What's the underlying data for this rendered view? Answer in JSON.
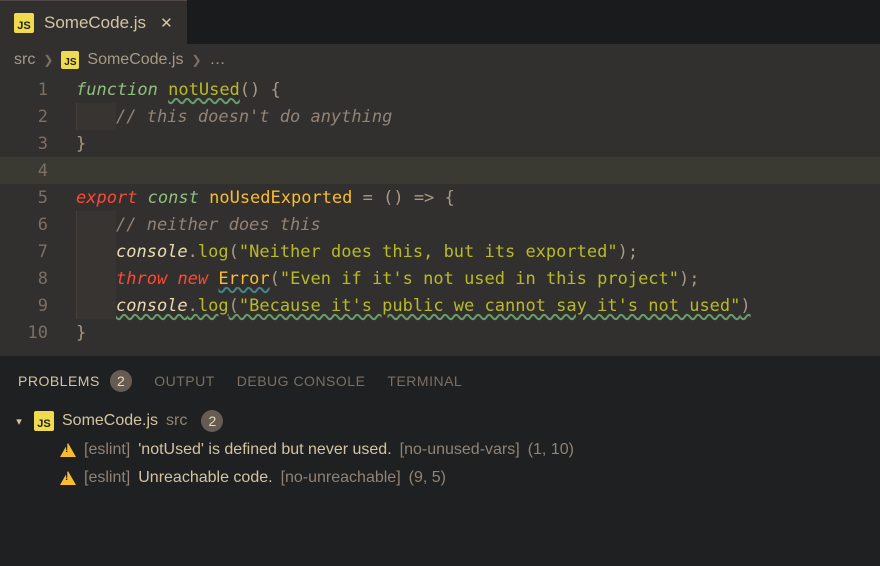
{
  "tab": {
    "title": "SomeCode.js"
  },
  "breadcrumb": {
    "root": "src",
    "file": "SomeCode.js",
    "more": "…"
  },
  "code": {
    "l1": {
      "kw": "function",
      "name": "notUsed",
      "tail": "() {"
    },
    "l2": {
      "comment": "// this doesn't do anything"
    },
    "l3": {
      "brace": "}"
    },
    "l5": {
      "export": "export",
      "const": "const",
      "name": "noUsedExported",
      "eq": " = () => {"
    },
    "l6": {
      "comment": "// neither does this"
    },
    "l7": {
      "obj": "console",
      "dot": ".",
      "fn": "log",
      "open": "(",
      "str": "\"Neither does this, but its exported\"",
      "close": ");"
    },
    "l8": {
      "throw": "throw",
      "new": "new",
      "err": "Error",
      "open": "(",
      "str": "\"Even if it's not used in this project\"",
      "close": ");"
    },
    "l9": {
      "obj": "console",
      "dot": ".",
      "fn": "log",
      "open": "(",
      "str": "\"Because it's public we cannot say it's not used\"",
      "close": ")"
    },
    "l10": {
      "brace": "}"
    }
  },
  "panel": {
    "tabs": {
      "problems": "PROBLEMS",
      "output": "OUTPUT",
      "debug": "DEBUG CONSOLE",
      "terminal": "TERMINAL"
    },
    "count": "2",
    "file": {
      "name": "SomeCode.js",
      "src": "src",
      "count": "2"
    },
    "items": [
      {
        "source": "[eslint]",
        "msg": "'notUsed' is defined but never used.",
        "rule": "[no-unused-vars]",
        "loc": "(1, 10)"
      },
      {
        "source": "[eslint]",
        "msg": "Unreachable code.",
        "rule": "[no-unreachable]",
        "loc": "(9, 5)"
      }
    ]
  }
}
